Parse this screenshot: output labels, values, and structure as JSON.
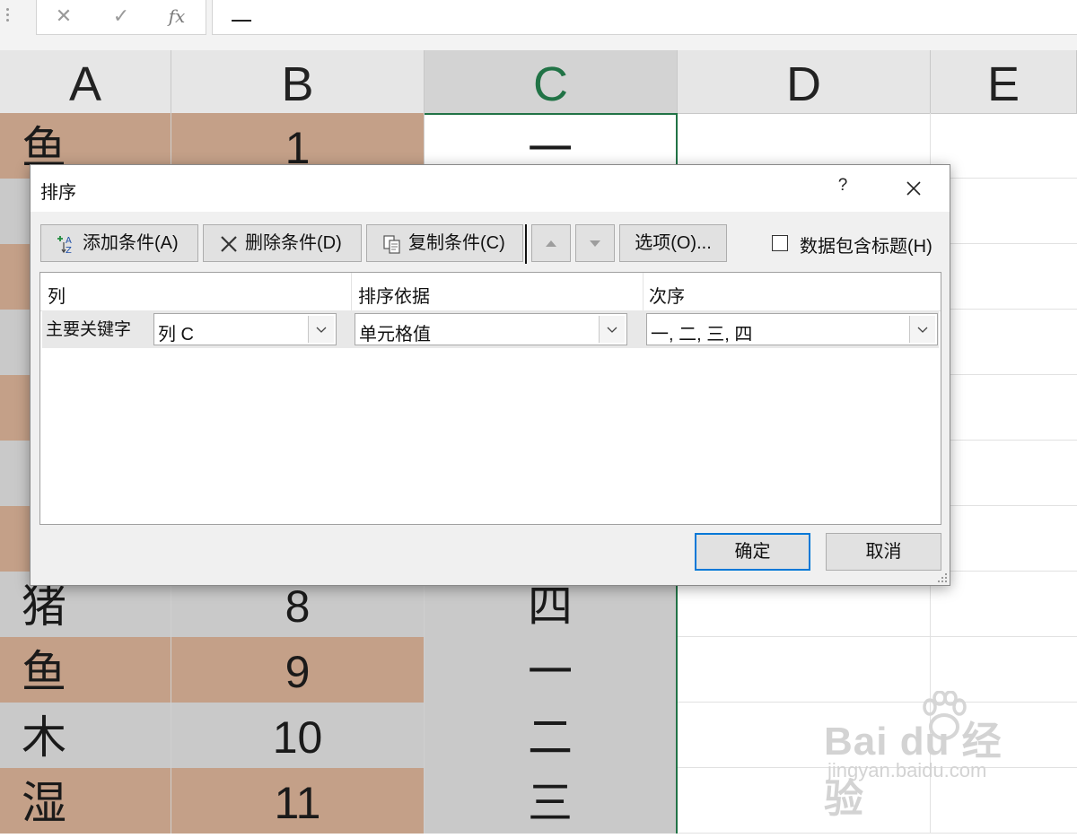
{
  "formula_bar": {
    "cancel_icon": "x-icon",
    "enter_icon": "check-icon",
    "fx_label": "fx",
    "value": "一"
  },
  "sheet": {
    "column_headers": [
      "A",
      "B",
      "C",
      "D",
      "E"
    ],
    "selected_column": "C",
    "rows": [
      {
        "a": "鱼",
        "b": "1",
        "c": "一"
      },
      {
        "a": "",
        "b": "",
        "c": ""
      },
      {
        "a": "",
        "b": "",
        "c": ""
      },
      {
        "a": "",
        "b": "",
        "c": ""
      },
      {
        "a": "",
        "b": "",
        "c": ""
      },
      {
        "a": "",
        "b": "",
        "c": ""
      },
      {
        "a": "",
        "b": "",
        "c": ""
      },
      {
        "a": "猪",
        "b": "8",
        "c": "四"
      },
      {
        "a": "鱼",
        "b": "9",
        "c": "一"
      },
      {
        "a": "木",
        "b": "10",
        "c": "二"
      },
      {
        "a": "湿",
        "b": "11",
        "c": "三"
      }
    ],
    "row_color_tan": "#c4a088",
    "row_color_gray": "#c9c9c9"
  },
  "dialog": {
    "title": "排序",
    "help_label": "?",
    "toolbar": {
      "add_label": "添加条件(A)",
      "delete_label": "删除条件(D)",
      "copy_label": "复制条件(C)",
      "options_label": "选项(O)...",
      "header_checkbox_label": "数据包含标题(H)",
      "header_checkbox_checked": false
    },
    "list": {
      "headers": {
        "column": "列",
        "basis": "排序依据",
        "order": "次序"
      },
      "rows": [
        {
          "label": "主要关键字",
          "column": "列 C",
          "basis": "单元格值",
          "order": "一, 二, 三, 四"
        }
      ]
    },
    "ok_label": "确定",
    "cancel_label": "取消",
    "accent_color": "#0078d7"
  },
  "watermark": {
    "brand": "Bai  du 经验",
    "url": "jingyan.baidu.com"
  }
}
